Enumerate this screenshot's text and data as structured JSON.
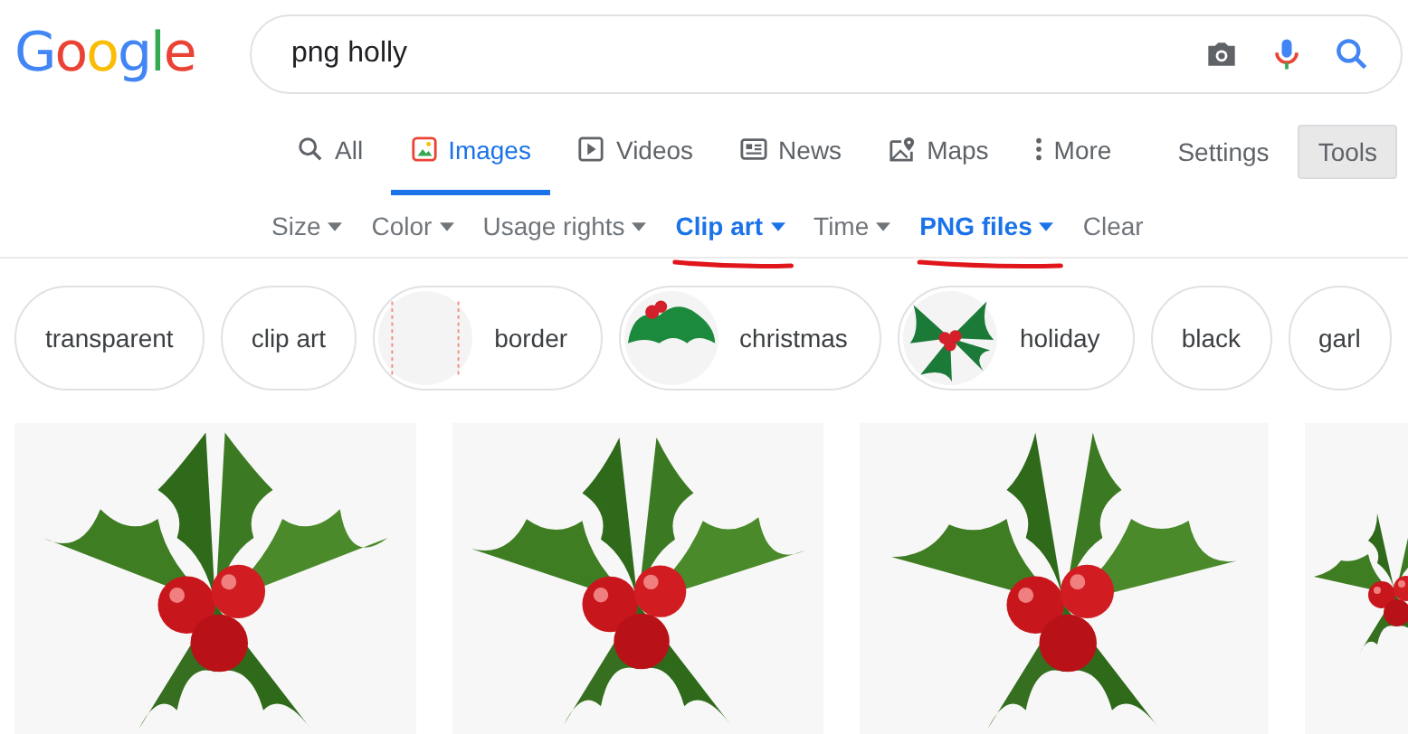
{
  "logo": [
    {
      "text": "G",
      "color": "#4285f4"
    },
    {
      "text": "o",
      "color": "#ea4335"
    },
    {
      "text": "o",
      "color": "#fbbc05"
    },
    {
      "text": "g",
      "color": "#4285f4"
    },
    {
      "text": "l",
      "color": "#34a853"
    },
    {
      "text": "e",
      "color": "#ea4335"
    }
  ],
  "search": {
    "value": "png holly"
  },
  "nav_tabs": [
    {
      "label": "All",
      "kind": "search",
      "selected": false
    },
    {
      "label": "Images",
      "kind": "image",
      "selected": true
    },
    {
      "label": "Videos",
      "kind": "play",
      "selected": false
    },
    {
      "label": "News",
      "kind": "news",
      "selected": false
    },
    {
      "label": "Maps",
      "kind": "map",
      "selected": false
    },
    {
      "label": "More",
      "kind": "dots",
      "selected": false
    }
  ],
  "settings": {
    "label": "Settings"
  },
  "tools": {
    "label": "Tools",
    "pressed": true
  },
  "filters": [
    {
      "label": "Size",
      "active": false,
      "marked": false
    },
    {
      "label": "Color",
      "active": false,
      "marked": false
    },
    {
      "label": "Usage rights",
      "active": false,
      "marked": false
    },
    {
      "label": "Clip art",
      "active": true,
      "marked": true
    },
    {
      "label": "Time",
      "active": false,
      "marked": false
    },
    {
      "label": "PNG files",
      "active": true,
      "marked": true
    }
  ],
  "clear": {
    "label": "Clear"
  },
  "chips": [
    {
      "label": "transparent",
      "kind": "plain"
    },
    {
      "label": "clip art",
      "kind": "plain"
    },
    {
      "label": "border",
      "kind": "border"
    },
    {
      "label": "christmas",
      "kind": "sprig"
    },
    {
      "label": "holiday",
      "kind": "wreath"
    },
    {
      "label": "black",
      "kind": "plain"
    },
    {
      "label": "garl",
      "kind": "plain"
    }
  ]
}
